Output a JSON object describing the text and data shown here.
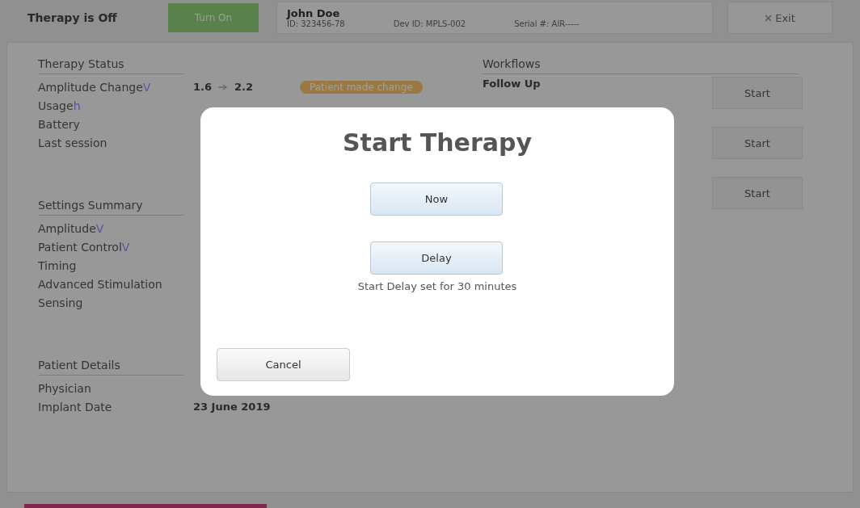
{
  "header": {
    "status": "Therapy is Off",
    "turn_on_button": "Turn On",
    "patient": {
      "name": "John Doe",
      "id": "ID: 323456-78",
      "device_id": "Dev ID: MPLS-002",
      "serial": "Serial #: AIR-----"
    },
    "exit_button": "Exit"
  },
  "therapy_status": {
    "title": "Therapy Status",
    "rows": [
      {
        "label": "Amplitude Change",
        "unit": "V",
        "from": "1.6",
        "to": "2.2",
        "badge": "Patient made change"
      },
      {
        "label": "Usage",
        "unit": "h"
      },
      {
        "label": "Battery"
      },
      {
        "label": "Last session"
      }
    ]
  },
  "settings_summary": {
    "title": "Settings Summary",
    "rows": [
      {
        "label": "Amplitude",
        "unit": "V"
      },
      {
        "label": "Patient Control",
        "unit": "V"
      },
      {
        "label": "Timing"
      },
      {
        "label": "Advanced Stimulation"
      },
      {
        "label": "Sensing"
      }
    ]
  },
  "patient_details": {
    "title": "Patient Details",
    "rows": [
      {
        "label": "Physician"
      },
      {
        "label": "Implant Date",
        "value": "23 June 2019"
      }
    ]
  },
  "workflows": {
    "title": "Workflows",
    "items": [
      {
        "name": "Follow Up"
      }
    ],
    "start_buttons": [
      "Start",
      "Start",
      "Start"
    ]
  },
  "dialog": {
    "title": "Start Therapy",
    "now_button": "Now",
    "delay_button": "Delay",
    "delay_note": "Start Delay set for 30 minutes",
    "cancel_button": "Cancel"
  }
}
